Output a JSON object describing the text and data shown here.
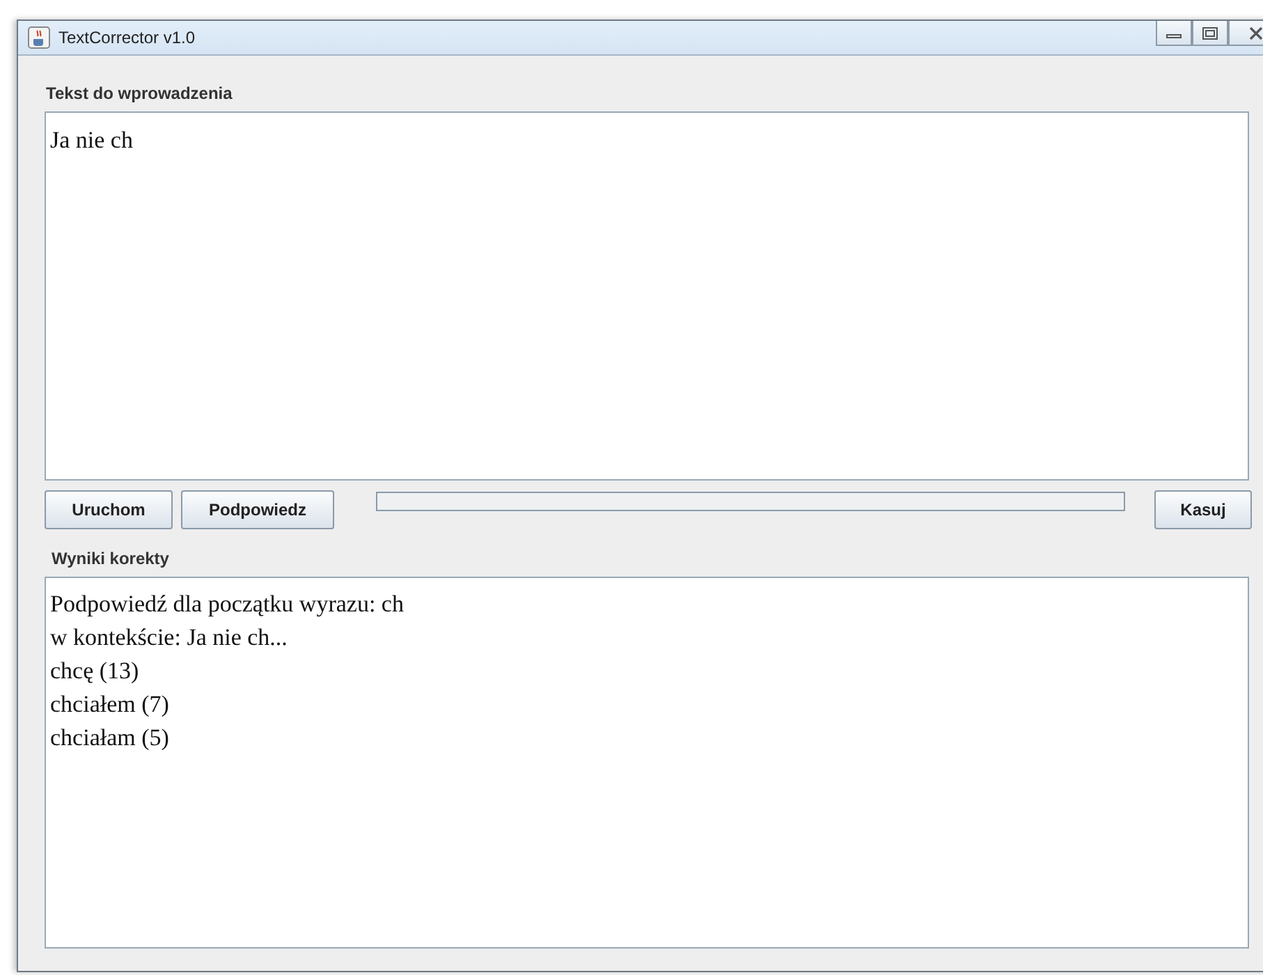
{
  "window": {
    "title": "TextCorrector v1.0"
  },
  "input": {
    "label": "Tekst do wprowadzenia",
    "value": "Ja nie ch"
  },
  "buttons": [
    {
      "label": "Uruchom"
    },
    {
      "label": "Podpowiedz"
    }
  ],
  "progress": {
    "level": 0
  },
  "clear_button": {
    "label": "Kasuj"
  },
  "results": {
    "label": "Wyniki korekty",
    "lines": [
      "Podpowiedź dla początku wyrazu: ch",
      "w kontekście: Ja nie ch...",
      "chcę (13)",
      "chciałem (7)",
      "chciałam (5)"
    ]
  }
}
